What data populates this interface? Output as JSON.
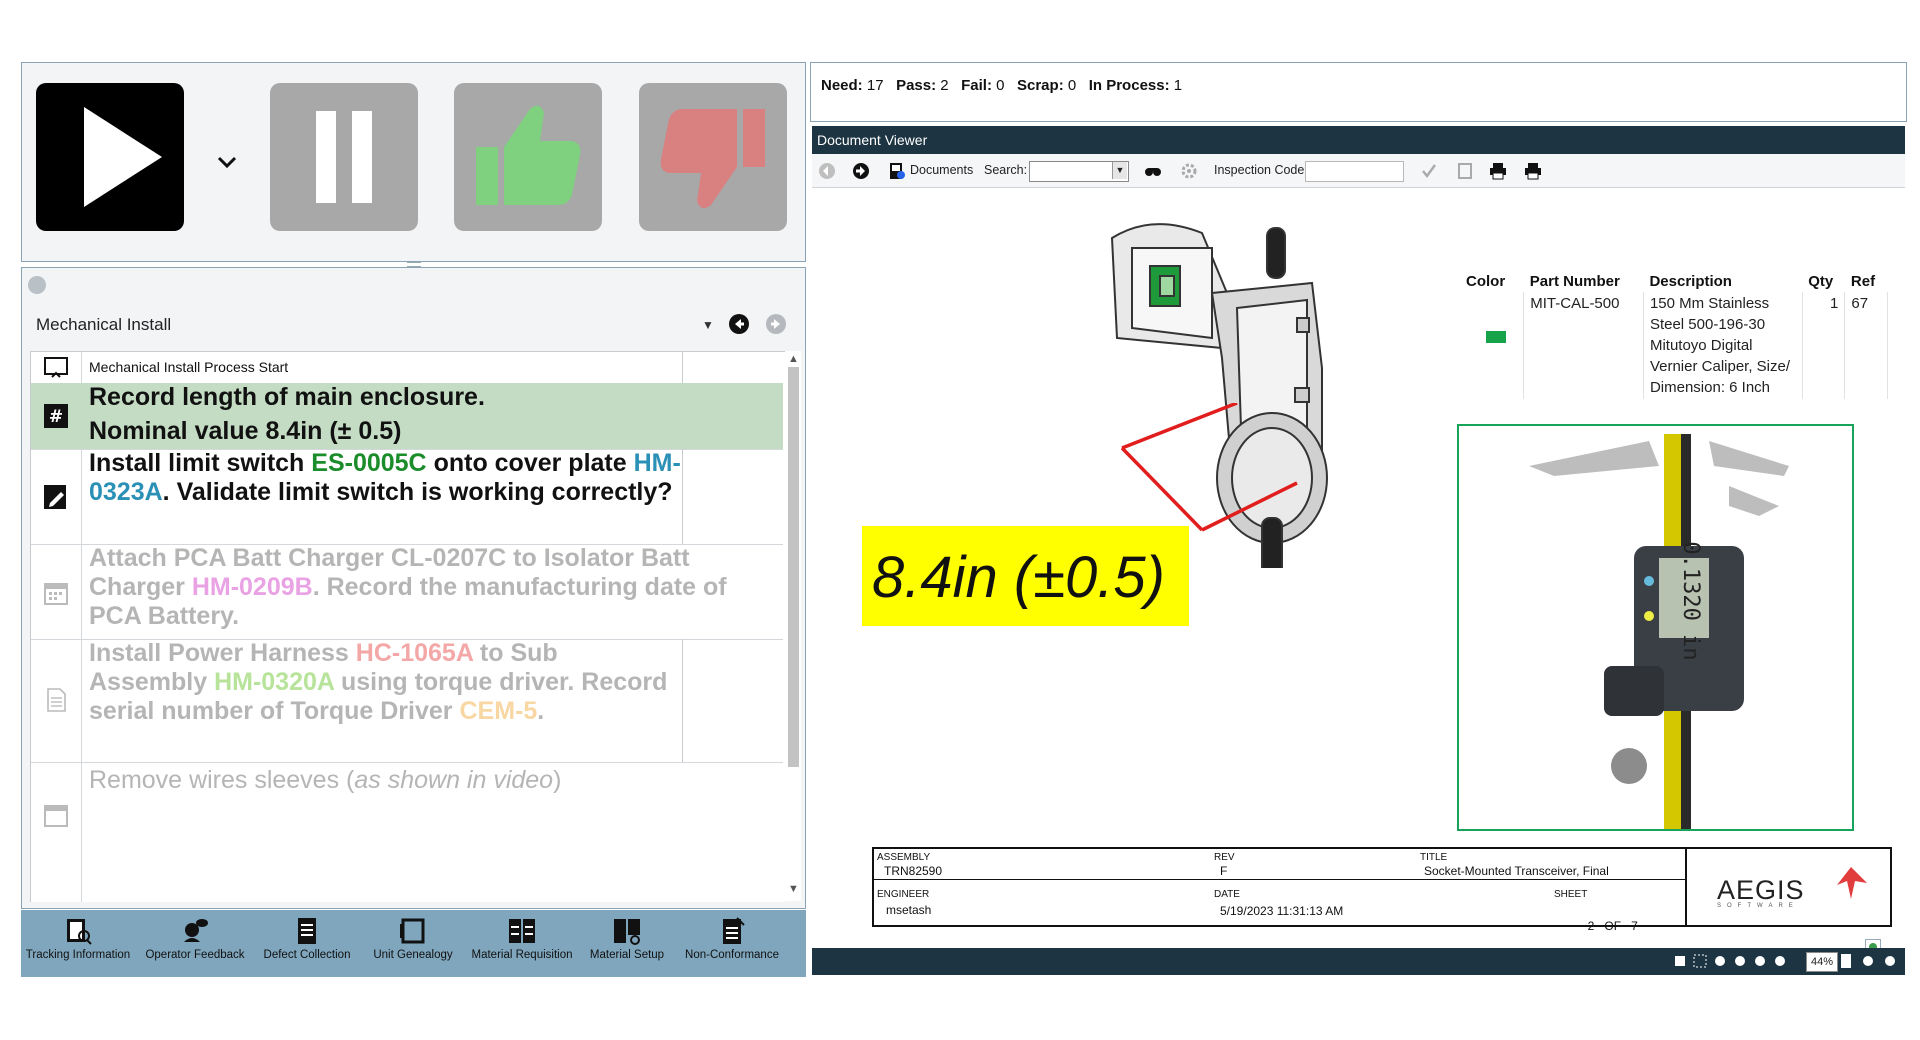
{
  "control_bar": {
    "play": "play-icon",
    "play_dropdown": "chevron-down-icon",
    "pause": "pause-icon",
    "pass": "thumbs-up-icon",
    "fail": "thumbs-down-icon"
  },
  "process": {
    "title": "Mechanical Install",
    "steps": [
      {
        "icon": "step-start-icon",
        "segments": [
          "Mechanical Install Process Start"
        ]
      },
      {
        "icon": "hash-icon",
        "segments": [
          "Record length of main enclosure.",
          "Nominal value 8.4in (± 0.5)"
        ]
      },
      {
        "icon": "edit-note-icon",
        "segments": [
          "Install limit switch ",
          "ES-0005C",
          " onto cover plate ",
          "HM-0323A",
          ". Validate limit switch is working correctly?"
        ]
      },
      {
        "icon": "calendar-icon",
        "segments": [
          "Attach PCA Batt Charger CL-0207C to Isolator Batt Charger ",
          "HM-0209B",
          ". Record the manufacturing date of PCA Battery."
        ]
      },
      {
        "icon": "document-icon",
        "segments": [
          "Install Power Harness ",
          "HC-1065A",
          " to Sub Assembly ",
          "HM-0320A",
          " using torque driver. Record serial number of Torque Driver ",
          "CEM-5",
          "."
        ]
      },
      {
        "icon": "calendar-icon",
        "segments": [
          "Remove wires sleeves (",
          "as shown in video",
          ")"
        ]
      }
    ]
  },
  "toolbar": {
    "items": [
      {
        "label": "Tracking Information",
        "icon": "tracking-icon"
      },
      {
        "label": "Operator Feedback",
        "icon": "feedback-icon"
      },
      {
        "label": "Defect Collection",
        "icon": "defect-icon"
      },
      {
        "label": "Unit Genealogy",
        "icon": "genealogy-icon"
      },
      {
        "label": "Material Requisition",
        "icon": "requisition-icon"
      },
      {
        "label": "Material Setup",
        "icon": "material-setup-icon"
      },
      {
        "label": "Non-Conformance",
        "icon": "non-conformance-icon"
      }
    ]
  },
  "stats": {
    "need_label": "Need:",
    "need": "17",
    "pass_label": "Pass:",
    "pass": "2",
    "fail_label": "Fail:",
    "fail": "0",
    "scrap_label": "Scrap:",
    "scrap": "0",
    "in_process_label": "In Process:",
    "in_process": "1"
  },
  "viewer": {
    "title": "Document Viewer",
    "documents_label": "Documents",
    "search_label": "Search:",
    "inspection_label": "Inspection Code",
    "zoom": "44%",
    "measure_text": "8.4in (±0.5)",
    "bom": {
      "headers": [
        "Color",
        "Part Number",
        "Description",
        "Qty",
        "Ref"
      ],
      "row": {
        "color": "#16a34a",
        "part_number": "MIT-CAL-500",
        "description": "150 Mm Stainless Steel 500-196-30 Mitutoyo Digital Vernier Caliper, Size/ Dimension: 6 Inch",
        "qty": "1",
        "ref": "67"
      }
    },
    "title_block": {
      "assembly_label": "ASSEMBLY",
      "assembly": "TRN82590",
      "rev_label": "REV",
      "rev": "F",
      "title_label": "TITLE",
      "title": "Socket-Mounted Transceiver, Final",
      "engineer_label": "ENGINEER",
      "engineer": "msetash",
      "date_label": "DATE",
      "date": "5/19/2023 11:31:13 AM",
      "sheet_label": "SHEET",
      "sheet": "2",
      "of_label": "OF",
      "sheet_total": "7",
      "logo_text": "AEGIS",
      "logo_sub": "SOFTWARE"
    },
    "caliper_display": "0.1320 in"
  },
  "colors": {
    "link_green": "#1a8c2a",
    "link_blue": "#2a90b5",
    "dim_pink": "#e9a2e3",
    "dim_red": "#f4a7a7",
    "dim_green": "#b8e39a",
    "dim_orange": "#f8d7a3",
    "active_row": "#c4dcc4"
  }
}
